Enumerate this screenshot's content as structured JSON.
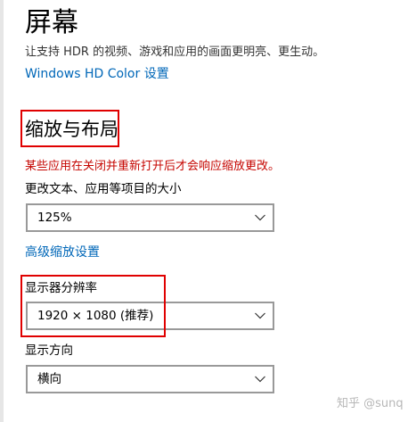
{
  "page": {
    "title": "屏幕",
    "subtitle": "让支持 HDR 的视频、游戏和应用的画面更明亮、更生动。",
    "hdr_link": "Windows HD Color 设置"
  },
  "scale_layout": {
    "heading": "缩放与布局",
    "warning": "某些应用在关闭并重新打开后才会响应缩放更改。",
    "scale_label": "更改文本、应用等项目的大小",
    "scale_value": "125%",
    "advanced_link": "高级缩放设置",
    "resolution_label": "显示器分辨率",
    "resolution_value": "1920 × 1080 (推荐)",
    "orientation_label": "显示方向",
    "orientation_value": "横向"
  },
  "icons": {
    "dropdown": "chevron-down-icon"
  },
  "colors": {
    "link": "#0067b8",
    "warning": "#c50500",
    "highlight_box": "#e00000"
  },
  "watermark": "知乎 @sunq"
}
